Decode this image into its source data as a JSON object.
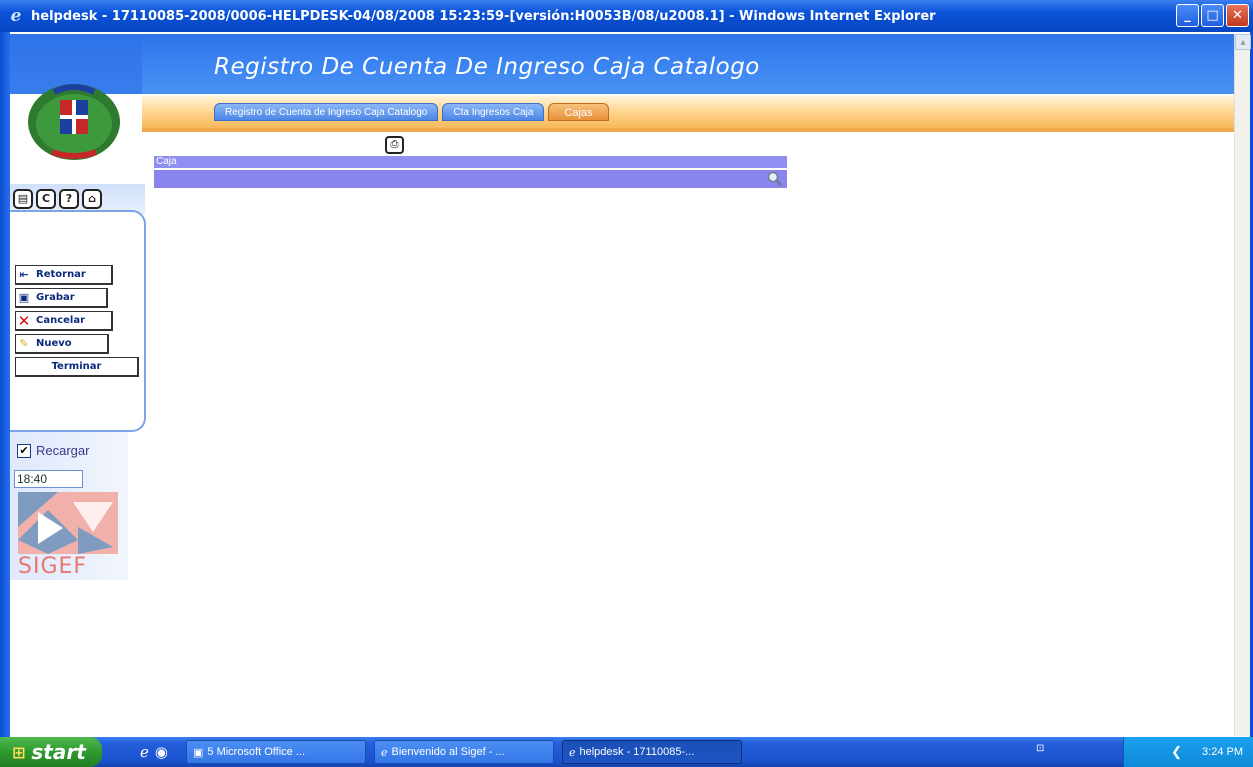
{
  "window": {
    "title": "helpdesk - 17110085-2008/0006-HELPDESK-04/08/2008 15:23:59-[versión:H0053B/08/u2008.1] - Windows Internet Explorer",
    "minimize_label": "_",
    "maximize_label": "□",
    "close_label": "✕"
  },
  "header": {
    "title": "Registro De Cuenta De Ingreso Caja Catalogo"
  },
  "tabs": [
    {
      "label": "Registro de Cuenta de Ingreso Caja Catalogo",
      "active": false
    },
    {
      "label": "Cta Ingresos Caja",
      "active": false
    },
    {
      "label": "Cajas",
      "active": true
    }
  ],
  "sidebar": {
    "toolbar_icons": [
      "document-icon",
      "refresh-icon",
      "help-icon",
      "home-icon"
    ],
    "buttons": [
      {
        "label": "Retornar",
        "icon": "back-arrow-icon",
        "glyph": "⇤"
      },
      {
        "label": "Grabar",
        "icon": "save-icon",
        "glyph": "🖫"
      },
      {
        "label": "Cancelar",
        "icon": "cancel-icon",
        "glyph": "✕"
      },
      {
        "label": "Nuevo",
        "icon": "pencil-icon",
        "glyph": "✎"
      },
      {
        "label": "Terminar",
        "icon": "",
        "glyph": ""
      }
    ],
    "reload_label": "Recargar",
    "reload_checked": true,
    "clock": "18:40",
    "logo_text": "SIGEF"
  },
  "form": {
    "caja_label": "Caja",
    "caja_value": ""
  },
  "taskbar": {
    "start_label": "start",
    "tasks": [
      {
        "label": "5 Microsoft Office ...",
        "active": false
      },
      {
        "label": "Bienvenido al Sigef - ...",
        "active": false
      },
      {
        "label": "helpdesk - 17110085-...",
        "active": true
      }
    ],
    "time": "3:24 PM"
  },
  "colors": {
    "title_bar": "#0a52d8",
    "header_blue": "#3d87f2",
    "header_orange": "#ffd58e",
    "active_tab": "#e8913a",
    "form_row": "#8a85ee",
    "taskbar": "#245edb",
    "start_button": "#2e9a2e"
  }
}
